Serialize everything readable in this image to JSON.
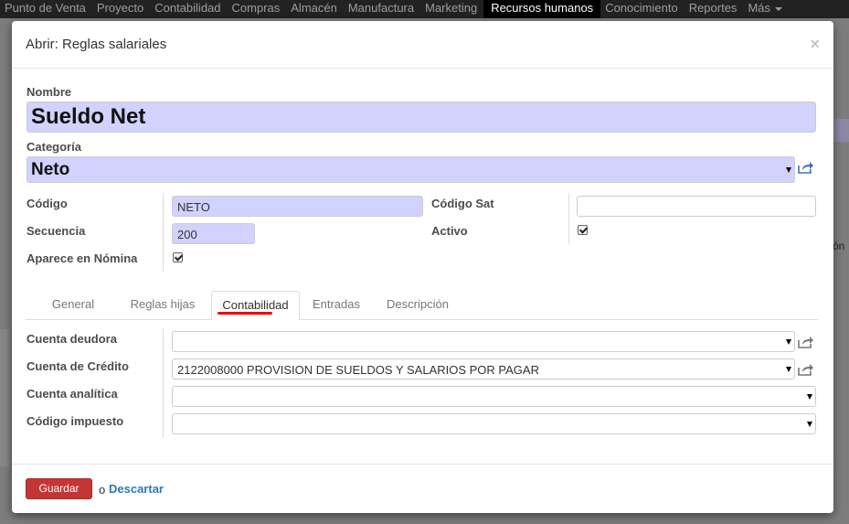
{
  "topnav": {
    "items": [
      "Punto de Venta",
      "Proyecto",
      "Contabilidad",
      "Compras",
      "Almacén",
      "Manufactura",
      "Marketing",
      "Recursos humanos",
      "Conocimiento",
      "Reportes",
      "Más"
    ],
    "active": "Recursos humanos"
  },
  "background": {
    "partial_text": "ón"
  },
  "modal": {
    "title": "Abrir: Reglas salariales",
    "close_symbol": "×",
    "fields": {
      "nombre_label": "Nombre",
      "nombre_value": "Sueldo Net",
      "categoria_label": "Categoría",
      "categoria_value": "Neto",
      "codigo_label": "Código",
      "codigo_value": "NETO",
      "secuencia_label": "Secuencia",
      "secuencia_value": "200",
      "aparece_label": "Aparece en Nómina",
      "aparece_checked": true,
      "codigo_sat_label": "Código Sat",
      "codigo_sat_value": "",
      "activo_label": "Activo",
      "activo_checked": true
    },
    "tabs": [
      {
        "label": "General",
        "active": false
      },
      {
        "label": "Reglas hijas",
        "active": false
      },
      {
        "label": "Contabilidad",
        "active": true
      },
      {
        "label": "Entradas",
        "active": false
      },
      {
        "label": "Descripción",
        "active": false
      }
    ],
    "accounting": {
      "cuenta_deudora_label": "Cuenta deudora",
      "cuenta_deudora_value": "",
      "cuenta_credito_label": "Cuenta de Crédito",
      "cuenta_credito_value": "2122008000 PROVISION DE SUELDOS Y SALARIOS POR PAGAR",
      "cuenta_analitica_label": "Cuenta analítica",
      "cuenta_analitica_value": "",
      "codigo_impuesto_label": "Código impuesto",
      "codigo_impuesto_value": ""
    },
    "footer": {
      "save_label": "Guardar",
      "or_text": "o",
      "discard_label": "Descartar"
    }
  },
  "colors": {
    "required_bg": "#d2d2ff",
    "save_button": "#c63535",
    "link": "#2a7ab0",
    "tab_highlight": "#ee0000"
  },
  "icons": {
    "external_link": "external-link-icon",
    "dropdown": "chevron-down-icon",
    "checkbox": "checkbox-icon",
    "close": "close-icon"
  }
}
